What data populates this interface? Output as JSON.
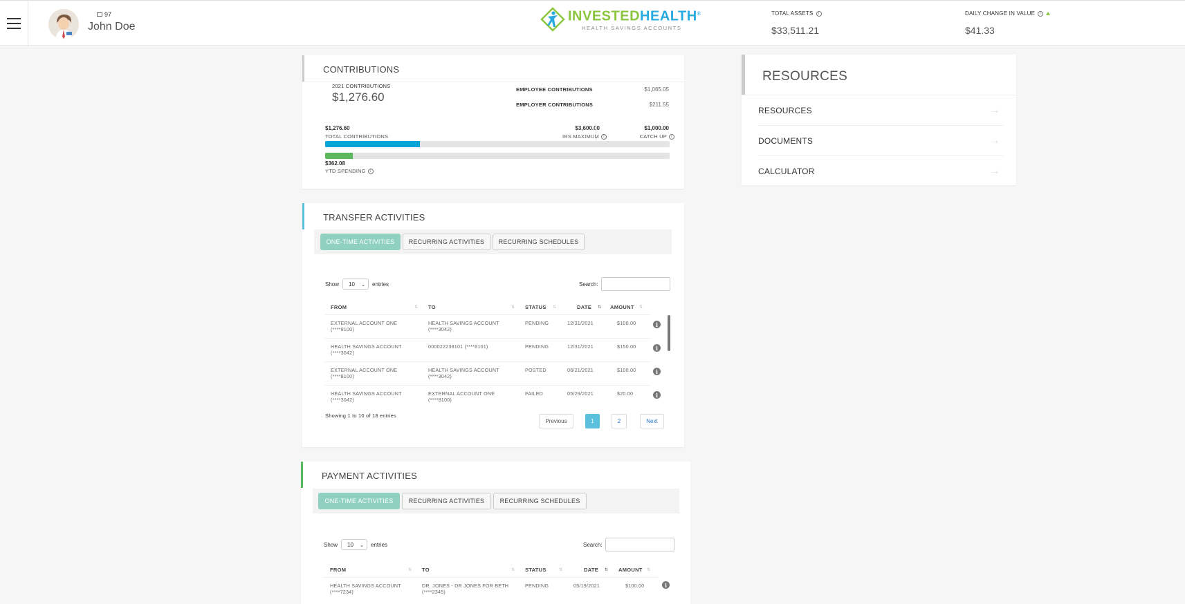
{
  "header": {
    "message_count": "97",
    "user_name": "John Doe",
    "logo": {
      "word1": "INVESTED",
      "word2": "HEALTH",
      "reg": "®",
      "tagline": "HEALTH SAVINGS ACCOUNTS"
    },
    "total_assets": {
      "label": "TOTAL ASSETS",
      "value": "$33,511.21"
    },
    "daily_change": {
      "label": "DAILY CHANGE IN VALUE",
      "value": "$41.33"
    }
  },
  "contributions": {
    "title": "CONTRIBUTIONS",
    "year_label": "2021 CONTRIBUTIONS",
    "year_value": "$1,276.60",
    "employee_label": "EMPLOYEE CONTRIBUTIONS",
    "employee_value": "$1,065.05",
    "employer_label": "EMPLOYER CONTRIBUTIONS",
    "employer_value": "$211.55",
    "total_value": "$1,276.60",
    "total_label": "TOTAL CONTRIBUTIONS",
    "irs_value": "$3,600.00",
    "irs_label": "IRS MAXIMUM",
    "catchup_value": "$1,000.00",
    "catchup_label": "CATCH UP",
    "contribution_progress": 0.276,
    "ytd_value": "$362.08",
    "ytd_label": "YTD SPENDING",
    "ytd_progress": 0.08,
    "colors": {
      "contribution_bar": "#06a7d8",
      "spending_bar": "#5cb85c"
    }
  },
  "transfer": {
    "title": "TRANSFER ACTIVITIES",
    "accent": "#5bc0de",
    "tabs": [
      "ONE-TIME ACTIVITIES",
      "RECURRING ACTIVITIES",
      "RECURRING SCHEDULES"
    ],
    "show_label": "Show",
    "entries_value": "10",
    "entries_label": "entries",
    "search_label": "Search:",
    "columns": [
      "FROM",
      "TO",
      "STATUS",
      "DATE",
      "AMOUNT"
    ],
    "rows": [
      {
        "from1": "EXTERNAL ACCOUNT ONE",
        "from2": "(****8100)",
        "to1": "HEALTH SAVINGS ACCOUNT",
        "to2": "(****3042)",
        "status": "PENDING",
        "date": "12/31/2021",
        "amount": "$100.00"
      },
      {
        "from1": "HEALTH SAVINGS ACCOUNT",
        "from2": "(****3042)",
        "to1": "000022238101 (****8101)",
        "to2": "",
        "status": "PENDING",
        "date": "12/31/2021",
        "amount": "$150.00"
      },
      {
        "from1": "EXTERNAL ACCOUNT ONE",
        "from2": "(****8100)",
        "to1": "HEALTH SAVINGS ACCOUNT",
        "to2": "(****3042)",
        "status": "POSTED",
        "date": "06/21/2021",
        "amount": "$100.00"
      },
      {
        "from1": "HEALTH SAVINGS ACCOUNT",
        "from2": "(****3042)",
        "to1": "EXTERNAL ACCOUNT ONE",
        "to2": "(****8100)",
        "status": "FAILED",
        "date": "05/29/2021",
        "amount": "$20.00"
      }
    ],
    "footer_text": "Showing 1 to 10 of 18 entries",
    "pager": {
      "previous": "Previous",
      "page1": "1",
      "page2": "2",
      "next": "Next"
    }
  },
  "payment": {
    "title": "PAYMENT ACTIVITIES",
    "accent": "#5cb85c",
    "tabs": [
      "ONE-TIME ACTIVITIES",
      "RECURRING ACTIVITIES",
      "RECURRING SCHEDULES"
    ],
    "show_label": "Show",
    "entries_value": "10",
    "entries_label": "entries",
    "search_label": "Search:",
    "columns": [
      "FROM",
      "TO",
      "STATUS",
      "DATE",
      "AMOUNT"
    ],
    "rows": [
      {
        "from1": "HEALTH SAVINGS ACCOUNT",
        "from2": "(****7234)",
        "to1": "DR. JONES - DR JONES FOR BETH",
        "to2": "(****2345)",
        "status": "PENDING",
        "date": "05/19/2021",
        "amount": "$100.00"
      }
    ]
  },
  "resources": {
    "title": "RESOURCES",
    "items": [
      "RESOURCES",
      "DOCUMENTS",
      "CALCULATOR"
    ]
  }
}
